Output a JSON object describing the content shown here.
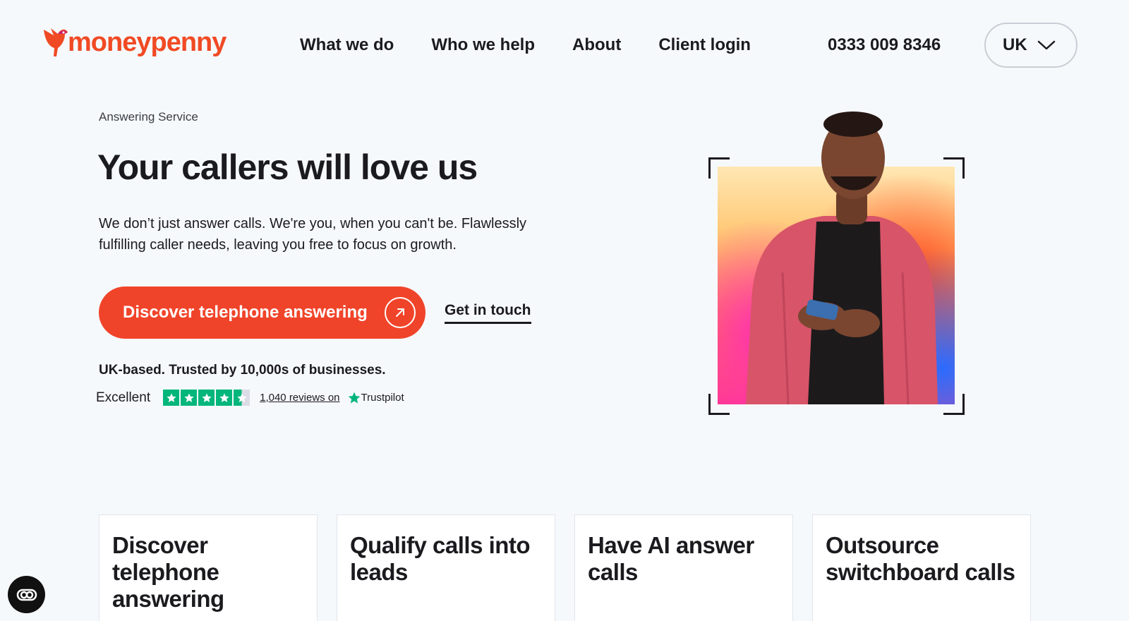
{
  "brand": {
    "name": "moneypenny",
    "color": "#f04a24"
  },
  "nav": {
    "items": [
      {
        "label": "What we do"
      },
      {
        "label": "Who we help"
      },
      {
        "label": "About"
      },
      {
        "label": "Client login"
      }
    ],
    "phone": "0333 009 8346",
    "region": "UK"
  },
  "hero": {
    "eyebrow": "Answering Service",
    "title": "Your callers will love us",
    "description": "We don’t just answer calls. We're you, when you can't be. Flawlessly fulfilling caller needs, leaving you free to focus on growth.",
    "cta_label": "Discover telephone answering",
    "secondary_label": "Get in touch",
    "trusted": "UK-based. Trusted by 10,000s of businesses.",
    "accent": "#f0442a"
  },
  "trustpilot": {
    "rating_text": "Excellent",
    "stars": 4.5,
    "reviews_text": "1,040 reviews on",
    "brand": "Trustpilot",
    "color": "#00b67a"
  },
  "cards": [
    {
      "title": "Discover telephone answering"
    },
    {
      "title": "Qualify calls into leads"
    },
    {
      "title": "Have AI answer calls"
    },
    {
      "title": "Outsource switchboard calls"
    }
  ],
  "icons": {
    "region_chevron": "chevron-down-icon",
    "cta_arrow": "arrow-up-right-icon",
    "accessibility": "accessibility-toggle-icon"
  }
}
